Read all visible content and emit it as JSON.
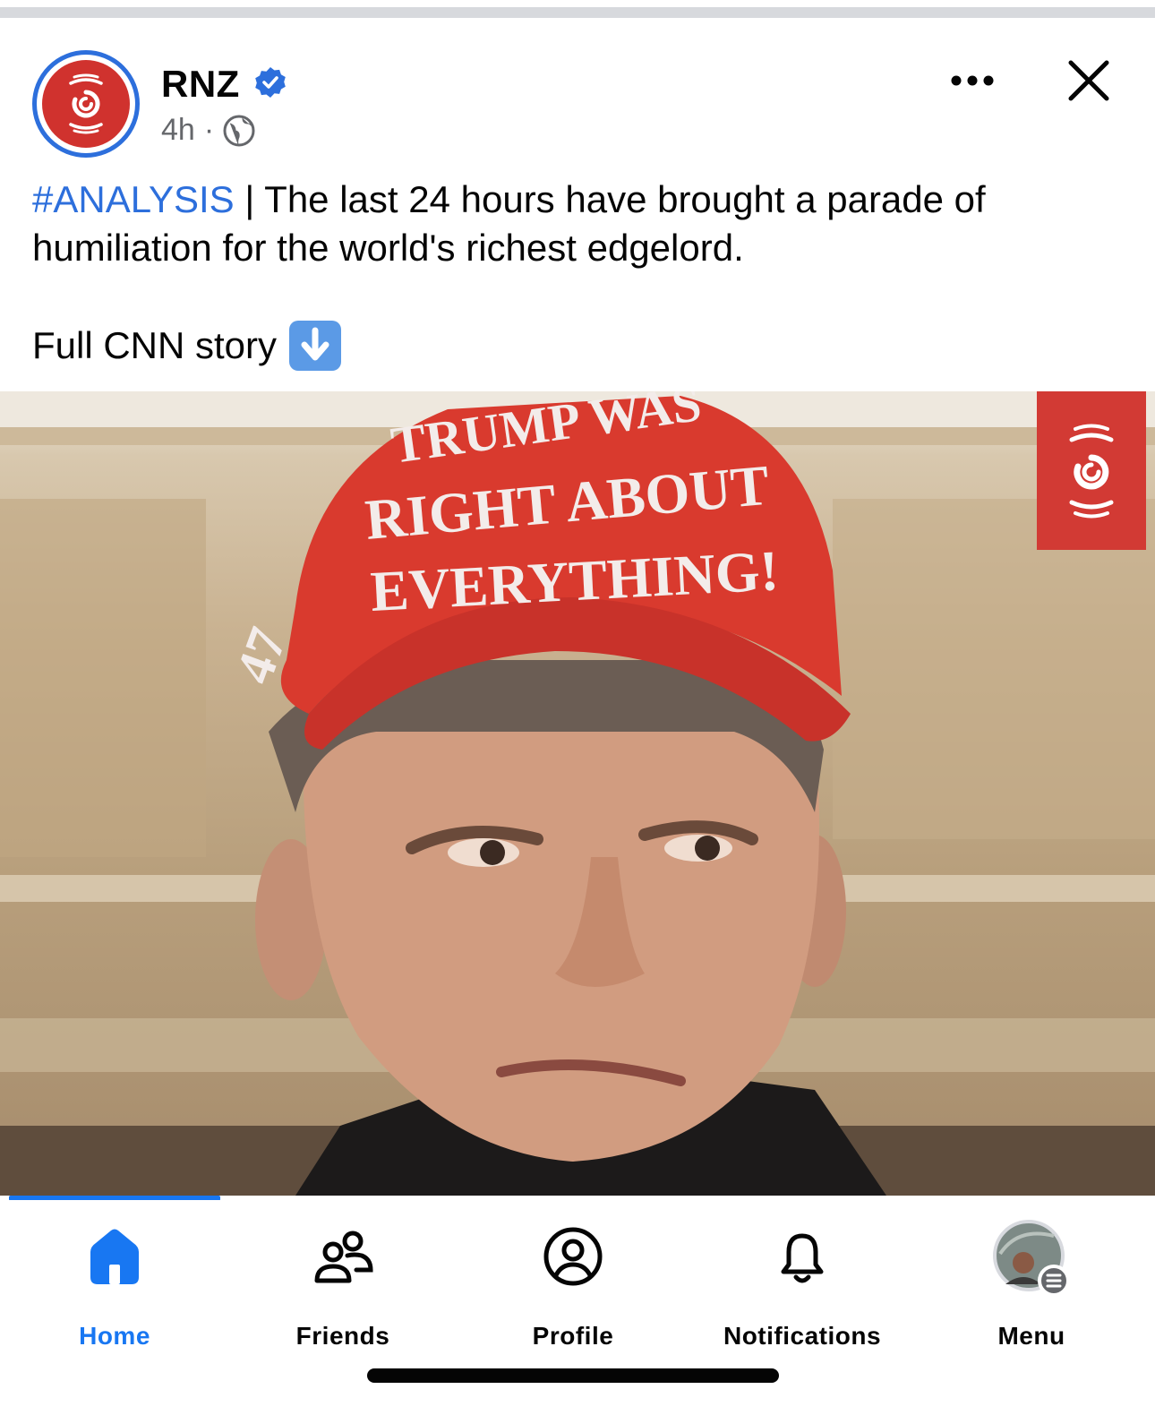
{
  "post": {
    "page_name": "RNZ",
    "time": "4h",
    "separator": "·",
    "hashtag": "#ANALYSIS",
    "text": " | The last 24 hours have brought a parade of humiliation for the world's richest edgelord.",
    "text2": "Full CNN story",
    "image_alt": "Photo of a man wearing a red cap that reads \"TRUMP WAS RIGHT ABOUT EVERYTHING!\""
  },
  "photo_caption_text": {
    "line1": "TRUMP WAS",
    "line2": "RIGHT ABOUT",
    "line3": "EVERYTHING!",
    "side": "47"
  },
  "nav": {
    "items": [
      {
        "label": "Home",
        "icon": "home-icon",
        "active": true
      },
      {
        "label": "Friends",
        "icon": "friends-icon",
        "active": false
      },
      {
        "label": "Profile",
        "icon": "profile-icon",
        "active": false
      },
      {
        "label": "Notifications",
        "icon": "bell-icon",
        "active": false
      },
      {
        "label": "Menu",
        "icon": "menu-avatar-icon",
        "active": false
      }
    ]
  },
  "colors": {
    "accent": "#1877f2",
    "hashtag": "#2d6fdc",
    "brand_red": "#d0322e",
    "secondary_text": "#65676b"
  }
}
